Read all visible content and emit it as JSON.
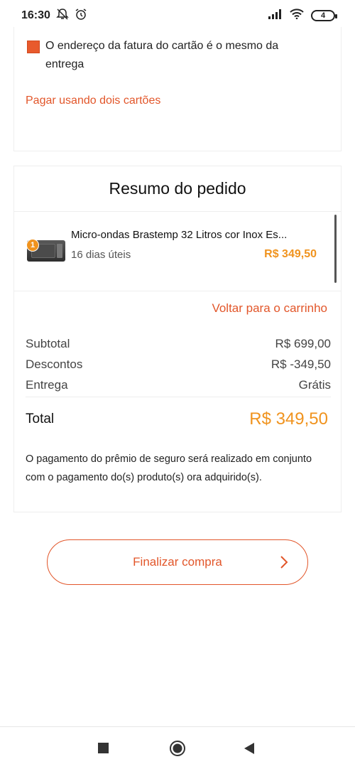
{
  "status_bar": {
    "time": "16:30",
    "battery": "4"
  },
  "billing": {
    "same_address_text": "O endereço da fatura do cartão é o mesmo da entrega",
    "same_address_checked": true,
    "two_cards_link": "Pagar usando dois cartões"
  },
  "summary": {
    "title": "Resumo do pedido",
    "item": {
      "quantity": "1",
      "name": "Micro-ondas Brastemp 32 Litros cor Inox Es...",
      "delivery": "16 dias úteis",
      "price": "R$ 349,50"
    },
    "back_to_cart": "Voltar para o carrinho",
    "subtotal_label": "Subtotal",
    "subtotal_value": "R$ 699,00",
    "discount_label": "Descontos",
    "discount_value": "R$ -349,50",
    "shipping_label": "Entrega",
    "shipping_value": "Grátis",
    "total_label": "Total",
    "total_value": "R$ 349,50",
    "insurance_note": "O pagamento do prêmio de seguro será realizado em conjunto com o pagamento do(s) produto(s) ora adquirido(s)."
  },
  "actions": {
    "finish_label": "Finalizar compra"
  },
  "colors": {
    "accent": "#e2562a",
    "price": "#f0931e"
  },
  "icons": {
    "mute": "bell-off-icon",
    "alarm": "alarm-icon",
    "signal": "signal-icon",
    "wifi": "wifi-icon",
    "battery": "battery-icon",
    "chevron": "chevron-right-icon",
    "nav_recent": "square-icon",
    "nav_home": "circle-icon",
    "nav_back": "triangle-back-icon"
  }
}
